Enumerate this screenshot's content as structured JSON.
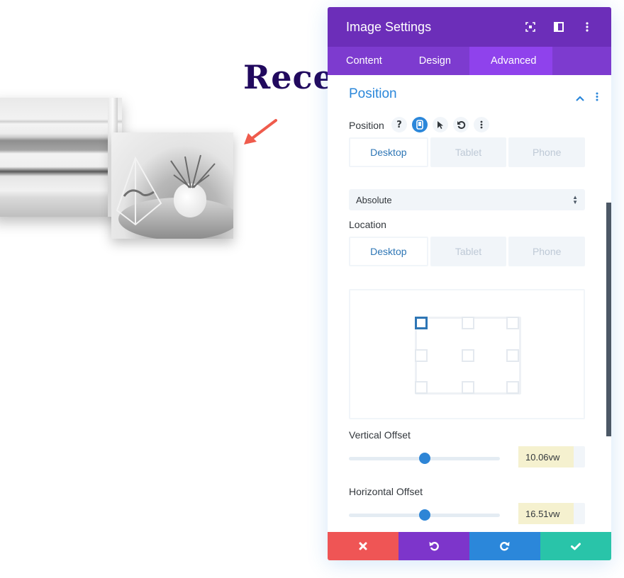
{
  "page": {
    "heading": "Rece",
    "images": [
      "bookshelf-image",
      "air-plant-image"
    ],
    "annotation_arrow_color": "#ef5b4c"
  },
  "panel": {
    "title": "Image Settings",
    "header_icons": [
      "fullscreen-icon",
      "split-view-icon",
      "more-options-icon"
    ],
    "tabs": [
      {
        "label": "Content",
        "active": false
      },
      {
        "label": "Design",
        "active": false
      },
      {
        "label": "Advanced",
        "active": true
      }
    ],
    "section": {
      "title": "Position",
      "expanded": true
    },
    "position_field": {
      "label": "Position",
      "help_icon": "?",
      "icons": [
        "help-icon",
        "responsive-icon",
        "hover-icon",
        "reset-icon",
        "more-icon"
      ],
      "device_tabs": [
        {
          "label": "Desktop",
          "active": true
        },
        {
          "label": "Tablet",
          "active": false
        },
        {
          "label": "Phone",
          "active": false
        }
      ],
      "select_value": "Absolute"
    },
    "location_field": {
      "label": "Location",
      "device_tabs": [
        {
          "label": "Desktop",
          "active": true
        },
        {
          "label": "Tablet",
          "active": false
        },
        {
          "label": "Phone",
          "active": false
        }
      ],
      "selected_location": "top-left",
      "locations": [
        "top-left",
        "top-center",
        "top-right",
        "center-left",
        "center",
        "center-right",
        "bottom-left",
        "bottom-center",
        "bottom-right"
      ]
    },
    "vertical_offset": {
      "label": "Vertical Offset",
      "value": "10.06vw",
      "slider_fraction": 0.5
    },
    "horizontal_offset": {
      "label": "Horizontal Offset",
      "value": "16.51vw",
      "slider_fraction": 0.5
    },
    "footer": {
      "buttons": [
        "cancel",
        "undo",
        "redo",
        "save"
      ]
    },
    "colors": {
      "header": "#6c2eb9",
      "tabs": "#7d3bcf",
      "active_tab": "#8f42ec",
      "accent": "#2b87da",
      "cancel": "#ef5555",
      "undo": "#7d35cb",
      "redo": "#2b87da",
      "save": "#29c4a9"
    }
  }
}
